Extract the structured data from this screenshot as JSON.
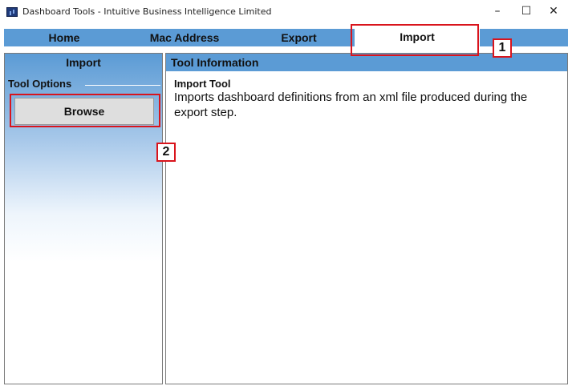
{
  "window": {
    "title": "Dashboard Tools - Intuitive Business Intelligence Limited",
    "minimize_glyph": "–",
    "maximize_glyph": "☐",
    "close_glyph": "✕"
  },
  "tabs": [
    {
      "label": "Home"
    },
    {
      "label": "Mac Address"
    },
    {
      "label": "Export"
    },
    {
      "label": "Import",
      "active": true
    }
  ],
  "left_panel": {
    "header": "Import",
    "section_label": "Tool Options",
    "browse_label": "Browse"
  },
  "right_panel": {
    "header": "Tool Information",
    "tool_name": "Import Tool",
    "description": "Imports dashboard definitions from an xml file produced during the export step."
  },
  "callouts": [
    {
      "number": "1"
    },
    {
      "number": "2"
    }
  ],
  "colors": {
    "accent_blue": "#5b9bd5",
    "callout_red": "#d9141c"
  }
}
